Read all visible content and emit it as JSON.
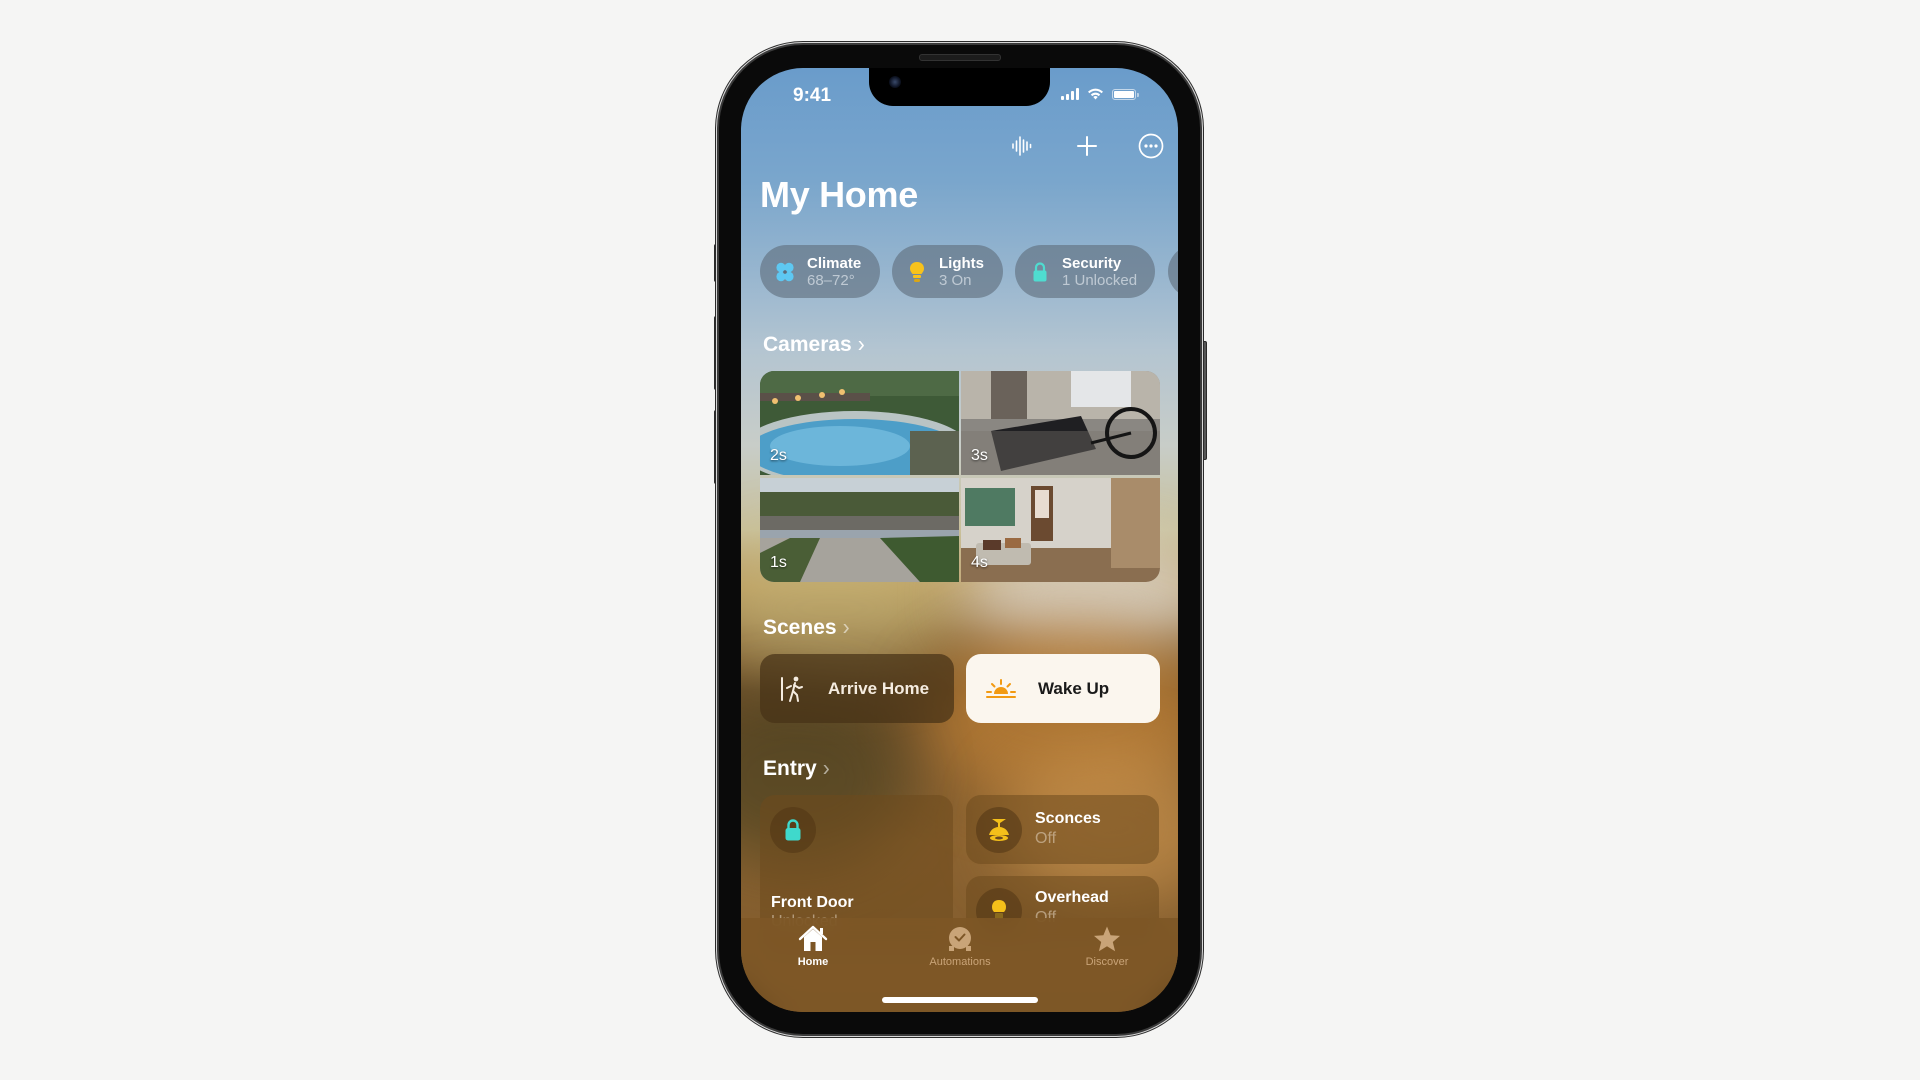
{
  "status_bar": {
    "time": "9:41",
    "signal_bars": 4,
    "wifi": "wifi-icon",
    "battery_level": 1.0
  },
  "toolbar": {
    "icons": [
      "waveform-icon",
      "plus-icon",
      "ellipsis-circle-icon"
    ]
  },
  "page_title": "My Home",
  "status_pills": [
    {
      "title": "Climate",
      "subtitle": "68–72°",
      "icon": "fan-icon",
      "icon_color": "#5ec8f2"
    },
    {
      "title": "Lights",
      "subtitle": "3 On",
      "icon": "lightbulb-icon",
      "icon_color": "#f7c21c"
    },
    {
      "title": "Security",
      "subtitle": "1 Unlocked",
      "icon": "lock-open-icon",
      "icon_color": "#4fdcd0"
    }
  ],
  "sections": {
    "cameras": {
      "title": "Cameras",
      "feeds": [
        {
          "name": "pool",
          "age_label": "2s"
        },
        {
          "name": "garage",
          "age_label": "3s"
        },
        {
          "name": "driveway",
          "age_label": "1s"
        },
        {
          "name": "living-room",
          "age_label": "4s"
        }
      ]
    },
    "scenes": {
      "title": "Scenes",
      "items": [
        {
          "label": "Arrive Home",
          "icon": "person-arrive-icon",
          "active": false
        },
        {
          "label": "Wake Up",
          "icon": "sunrise-icon",
          "active": true
        }
      ]
    },
    "entry": {
      "title": "Entry",
      "accessories": [
        {
          "title": "Front Door",
          "subtitle": "Unlocked",
          "icon": "lock-icon",
          "icon_color": "#3fd9cc"
        },
        {
          "title": "Sconces",
          "subtitle": "Off",
          "icon": "pendant-lamp-icon",
          "icon_color": "#f5c01a"
        },
        {
          "title": "Overhead",
          "subtitle": "Off",
          "icon": "lightbulb-icon",
          "icon_color": "#f5c01a"
        }
      ]
    }
  },
  "tab_bar": {
    "tabs": [
      {
        "label": "Home",
        "icon": "house-icon",
        "selected": true
      },
      {
        "label": "Automations",
        "icon": "clock-check-icon",
        "selected": false
      },
      {
        "label": "Discover",
        "icon": "star-icon",
        "selected": false
      }
    ]
  }
}
